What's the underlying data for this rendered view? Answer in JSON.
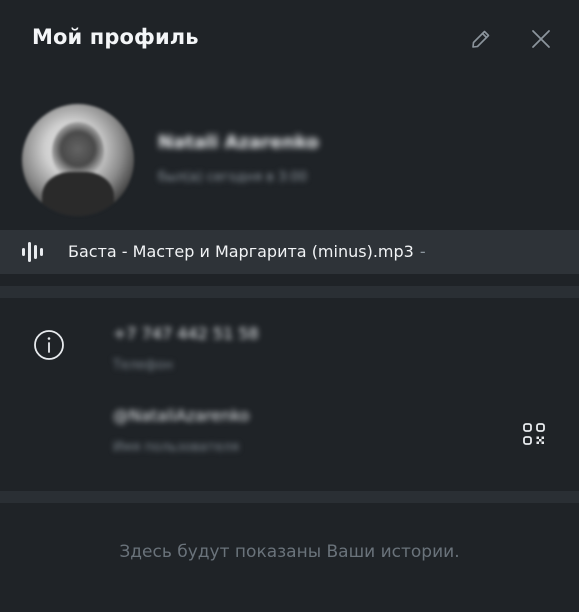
{
  "header": {
    "title": "Мой профиль",
    "edit_icon": "pencil-icon",
    "close_icon": "close-icon"
  },
  "profile": {
    "name": "Natali Azarenko",
    "status": "был(а) сегодня в 3:00"
  },
  "music": {
    "icon": "audio-waveform-icon",
    "title": "Баста - Мастер и Маргарита (minus).mp3",
    "suffix": "-"
  },
  "info": {
    "icon": "info-icon",
    "phone": "+7 747 442 51 58",
    "phone_label": "Телефон",
    "username": "@NataliAzarenko",
    "username_label": "Имя пользователя",
    "qr_icon": "qr-code-icon"
  },
  "stories": {
    "empty_text": "Здесь будут показаны Ваши истории."
  },
  "colors": {
    "background": "#1f2327",
    "music_bar": "#2e3338",
    "divider": "#2a2f34",
    "muted_text": "#6a737b"
  }
}
